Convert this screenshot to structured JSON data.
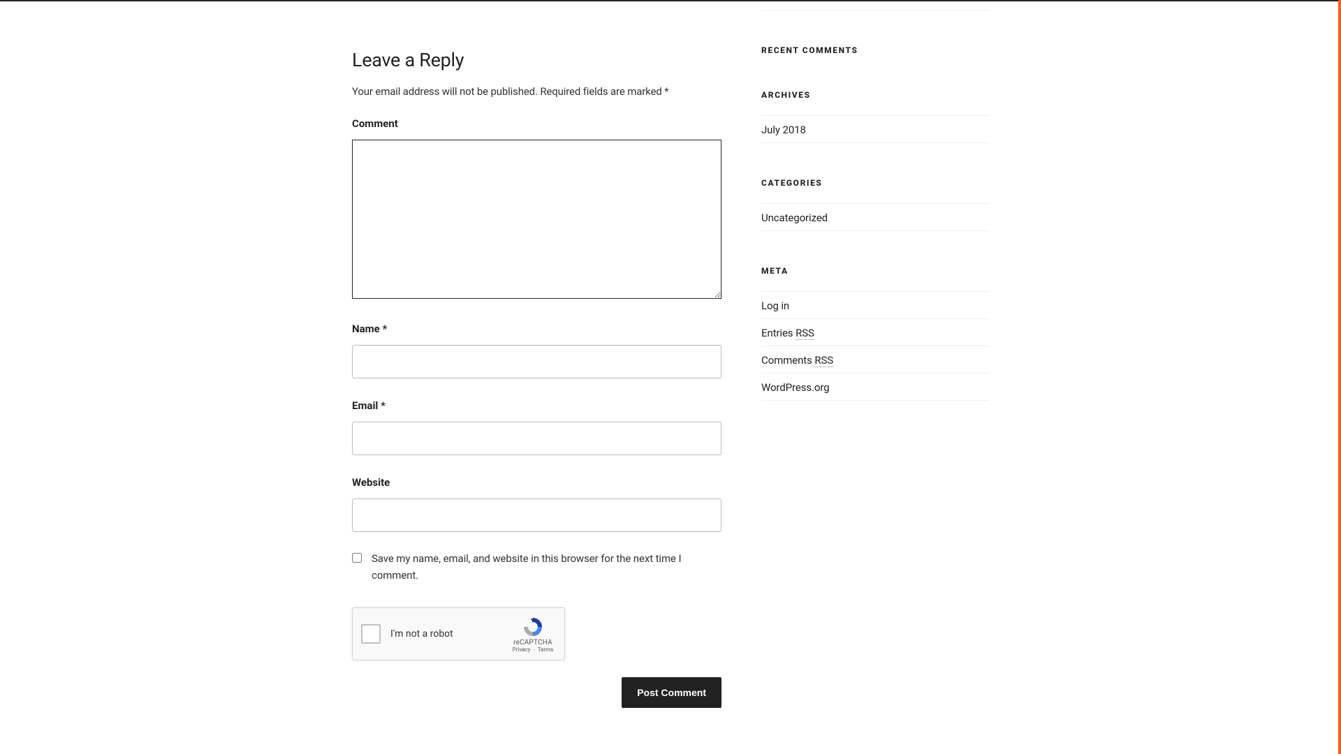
{
  "form": {
    "title": "Leave a Reply",
    "notes_line1": "Your email address will not be published.",
    "notes_line2": "Required fields are marked *",
    "comment_label": "Comment",
    "comment_value": "",
    "name_label": "Name ",
    "name_required": "*",
    "name_value": "",
    "email_label": "Email ",
    "email_required": "*",
    "email_value": "",
    "website_label": "Website",
    "website_value": "",
    "save_label": "Save my name, email, and website in this browser for the next time I comment.",
    "recaptcha_label": "I'm not a robot",
    "recaptcha_brand": "reCAPTCHA",
    "recaptcha_privacy": "Privacy",
    "recaptcha_terms": "Terms",
    "recaptcha_dash": " - ",
    "submit_label": "Post Comment"
  },
  "sidebar": {
    "recent_comments_title": "RECENT COMMENTS",
    "archives_title": "ARCHIVES",
    "archives": [
      {
        "label": "July 2018"
      }
    ],
    "categories_title": "CATEGORIES",
    "categories": [
      {
        "label": "Uncategorized"
      }
    ],
    "meta_title": "META",
    "meta": {
      "login": "Log in",
      "entries_prefix": "Entries ",
      "entries_rss": "RSS",
      "comments_prefix": "Comments ",
      "comments_rss": "RSS",
      "wporg": "WordPress.org"
    }
  }
}
